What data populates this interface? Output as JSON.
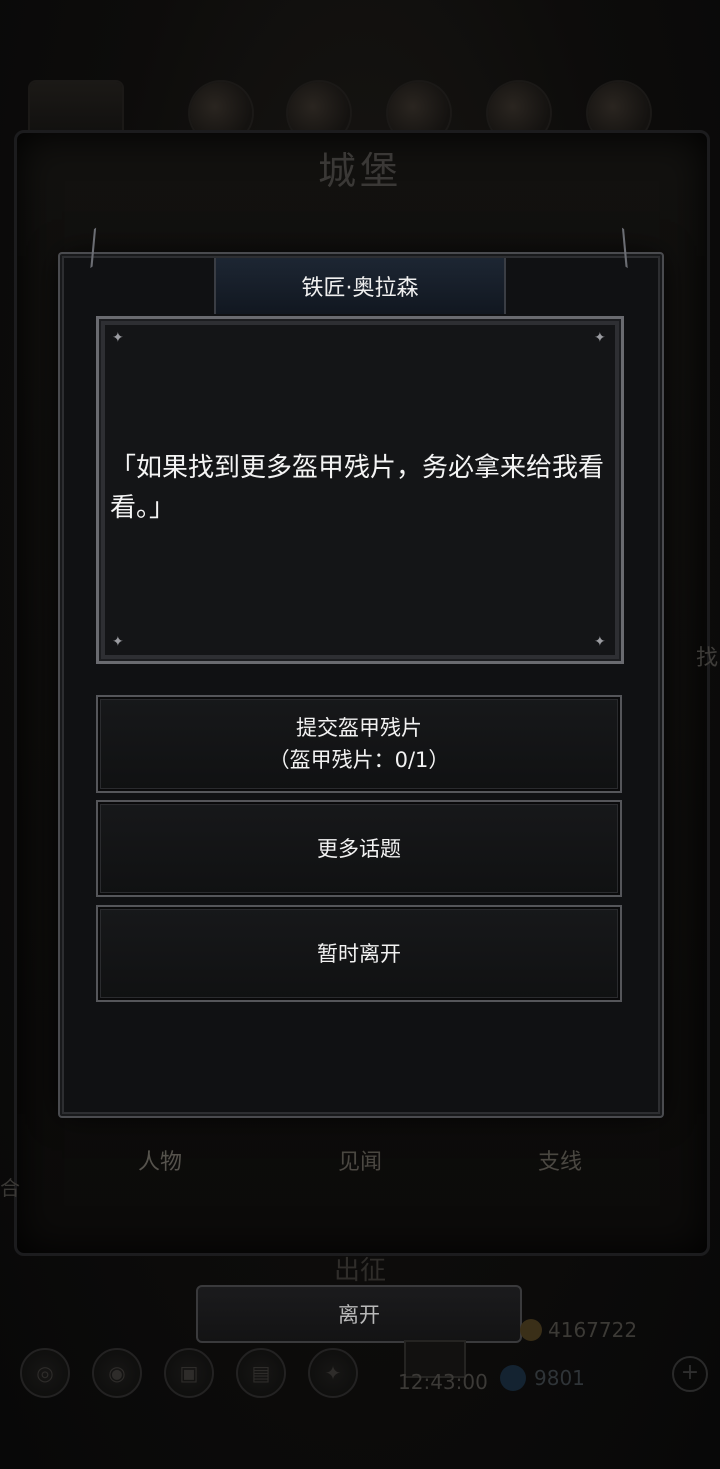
{
  "background": {
    "screen_title": "城堡",
    "tabs": [
      {
        "label": "人物"
      },
      {
        "label": "见闻"
      },
      {
        "label": "支线"
      }
    ],
    "side_text_right": "找",
    "side_text_left": "合",
    "expedition_label": "出征",
    "leave_label": "离开",
    "gold": "4167722",
    "gems": "9801",
    "time": "12:43:00"
  },
  "dialog": {
    "npc_name": "铁匠·奥拉森",
    "speech": "「如果找到更多盔甲残片，务必拿来给我看看。」",
    "options": [
      {
        "label": "提交盔甲残片",
        "sub": "（盔甲残片：0/1）"
      },
      {
        "label": "更多话题"
      },
      {
        "label": "暂时离开"
      }
    ]
  },
  "colors": {
    "dialog_bg": "#101113",
    "header_bg": "#1d2633",
    "text": "#f4f4f4"
  }
}
